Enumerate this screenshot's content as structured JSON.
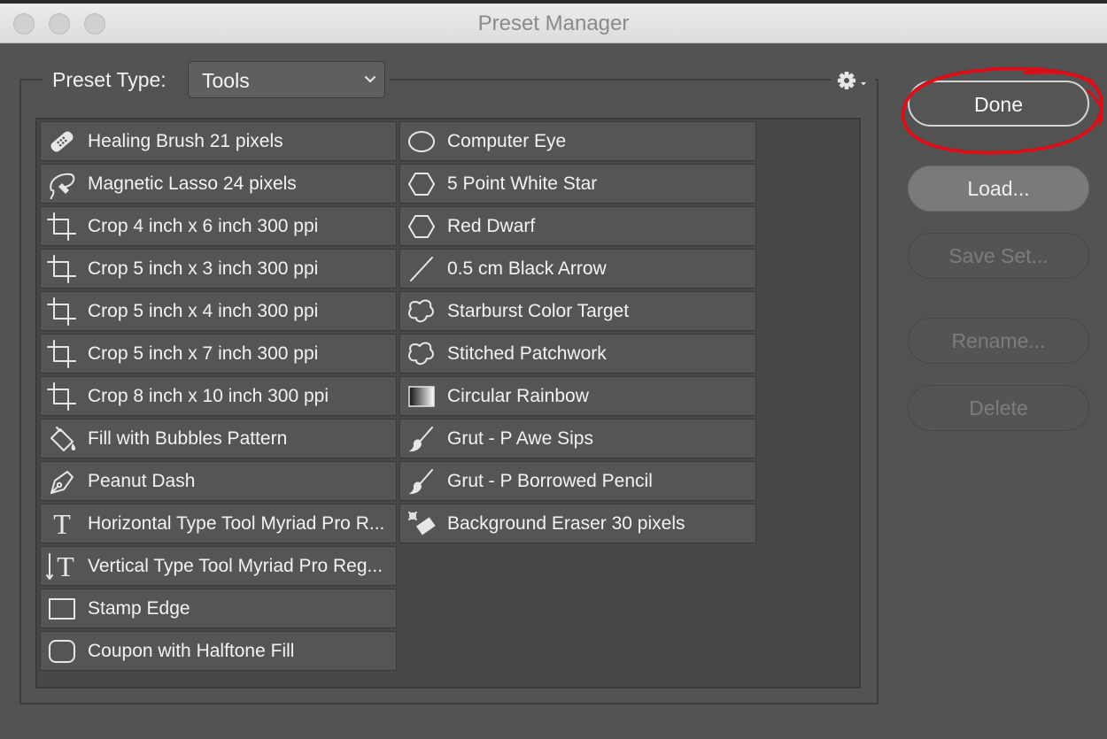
{
  "window": {
    "title": "Preset Manager"
  },
  "preset_type": {
    "label": "Preset Type:",
    "selected": "Tools"
  },
  "buttons": {
    "done": "Done",
    "load": "Load...",
    "save_set": "Save Set...",
    "rename": "Rename...",
    "delete": "Delete"
  },
  "annotation": {
    "circle_color": "#d9101a",
    "target": "Done"
  },
  "presets": {
    "column1": [
      {
        "label": "Healing Brush 21 pixels",
        "icon": "healing-brush-icon"
      },
      {
        "label": "Magnetic Lasso 24 pixels",
        "icon": "magnetic-lasso-icon"
      },
      {
        "label": "Crop 4 inch x 6 inch 300 ppi",
        "icon": "crop-icon"
      },
      {
        "label": "Crop 5 inch x 3 inch 300 ppi",
        "icon": "crop-icon"
      },
      {
        "label": "Crop 5 inch x 4 inch 300 ppi",
        "icon": "crop-icon"
      },
      {
        "label": "Crop 5 inch x 7 inch 300 ppi",
        "icon": "crop-icon"
      },
      {
        "label": "Crop 8 inch x 10 inch 300 ppi",
        "icon": "crop-icon"
      },
      {
        "label": "Fill with Bubbles Pattern",
        "icon": "paint-bucket-icon"
      },
      {
        "label": "Peanut Dash",
        "icon": "pen-icon"
      },
      {
        "label": "Horizontal Type Tool Myriad Pro R...",
        "icon": "horizontal-type-icon"
      },
      {
        "label": "Vertical Type Tool Myriad Pro Reg...",
        "icon": "vertical-type-icon"
      },
      {
        "label": "Stamp Edge",
        "icon": "rectangle-icon"
      },
      {
        "label": "Coupon with Halftone Fill",
        "icon": "rounded-rectangle-icon"
      }
    ],
    "column2": [
      {
        "label": "Computer Eye",
        "icon": "ellipse-icon"
      },
      {
        "label": "5 Point White Star",
        "icon": "polygon-icon"
      },
      {
        "label": "Red Dwarf",
        "icon": "polygon-icon"
      },
      {
        "label": "0.5 cm Black Arrow",
        "icon": "line-icon"
      },
      {
        "label": "Starburst Color Target",
        "icon": "custom-shape-icon"
      },
      {
        "label": "Stitched Patchwork",
        "icon": "custom-shape-icon"
      },
      {
        "label": "Circular Rainbow",
        "icon": "gradient-icon"
      },
      {
        "label": "Grut - P Awe Sips",
        "icon": "brush-icon"
      },
      {
        "label": "Grut - P Borrowed Pencil",
        "icon": "brush-icon"
      },
      {
        "label": "Background Eraser 30 pixels",
        "icon": "background-eraser-icon"
      }
    ]
  }
}
